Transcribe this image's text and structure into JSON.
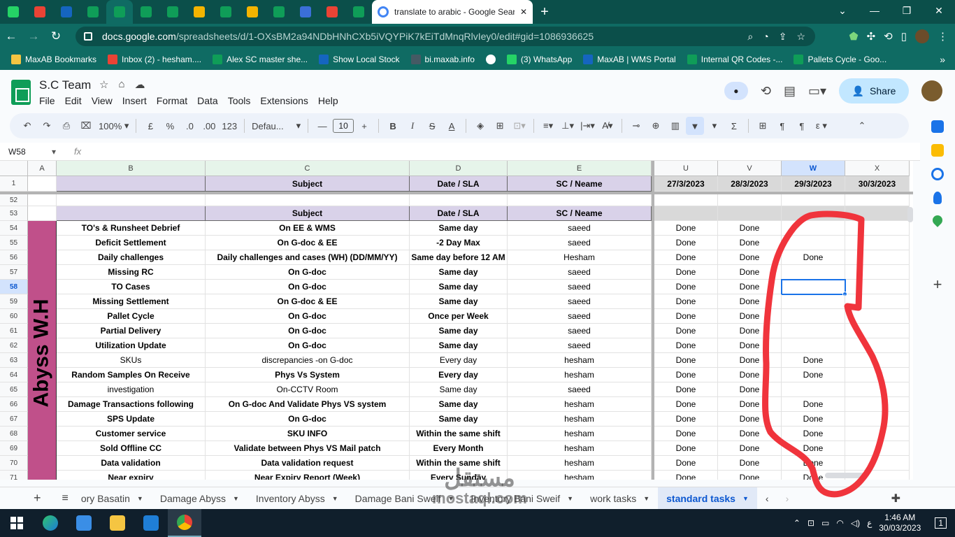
{
  "browser": {
    "active_tab_title": "translate to arabic - Google Search",
    "url_domain": "docs.google.com",
    "url_path": "/spreadsheets/d/1-OXsBM2a94NDbHNhCXb5iVQYPiK7kEiTdMnqRlvIey0/edit#gid=1086936625",
    "tab_icons": [
      "whatsapp-icon",
      "gmail-icon",
      "maxab-icon",
      "sheets-icon",
      "sheets-icon",
      "sheets-icon",
      "sheets-icon",
      "slides-icon",
      "sheets-icon",
      "slides-icon",
      "sheets-icon",
      "maxab-m-icon",
      "gmail-icon",
      "sheets-icon"
    ],
    "bookmarks": [
      {
        "label": "MaxAB Bookmarks",
        "icon": "folder-icon"
      },
      {
        "label": "Inbox (2) - hesham....",
        "icon": "gmail-icon"
      },
      {
        "label": "Alex SC master she...",
        "icon": "sheets-icon"
      },
      {
        "label": "Show Local Stock",
        "icon": "maxab-icon"
      },
      {
        "label": "bi.maxab.info",
        "icon": "site-icon"
      },
      {
        "label": "",
        "icon": "globe-icon"
      },
      {
        "label": "(3) WhatsApp",
        "icon": "whatsapp-icon"
      },
      {
        "label": "MaxAB | WMS Portal",
        "icon": "maxab-icon"
      },
      {
        "label": "Internal QR Codes -...",
        "icon": "sheets-icon"
      },
      {
        "label": "Pallets Cycle - Goo...",
        "icon": "sheets-icon"
      }
    ]
  },
  "doc": {
    "title": "S.C Team",
    "menu": [
      "File",
      "Edit",
      "View",
      "Insert",
      "Format",
      "Data",
      "Tools",
      "Extensions",
      "Help"
    ],
    "share_label": "Share"
  },
  "toolbar": {
    "zoom": "100%",
    "currency": "£",
    "percent": "%",
    "dec_decrease": ".0",
    "dec_increase": ".00",
    "number_format": "123",
    "font": "Defau...",
    "font_size": "10"
  },
  "formula_bar": {
    "cell_ref": "W58",
    "fx": "fx"
  },
  "grid": {
    "left_columns": [
      "A",
      "B",
      "C",
      "D",
      "E"
    ],
    "right_columns": [
      "U",
      "V",
      "W",
      "X"
    ],
    "selected_column": "W",
    "header_row_num": "1",
    "header_cells": {
      "B": "",
      "C": "Subject",
      "D": "Date / SLA",
      "E": "SC / Neame"
    },
    "dates": [
      "27/3/2023",
      "28/3/2023",
      "29/3/2023",
      "30/3/2023"
    ],
    "row52": "52",
    "row53": {
      "num": "53",
      "B": "",
      "C": "Subject",
      "D": "Date / SLA",
      "E": "SC / Neame"
    },
    "group_label": "Abyss W.H",
    "selected_row": "58",
    "rows": [
      {
        "num": "54",
        "task": "TO's & Runsheet Debrief",
        "subject": "On EE & WMS",
        "sla": "Same day",
        "sc": "saeed",
        "u": "Done",
        "v": "Done",
        "w": "",
        "bold": true
      },
      {
        "num": "55",
        "task": "Deficit Settlement",
        "subject": "On G-doc & EE",
        "sla": "-2 Day Max",
        "sc": "saeed",
        "u": "Done",
        "v": "Done",
        "w": "",
        "bold": true
      },
      {
        "num": "56",
        "task": "Daily challenges",
        "subject": "Daily challenges and cases (WH) (DD/MM/YY)",
        "sla": "Same day before 12 AM",
        "sc": "Hesham",
        "u": "Done",
        "v": "Done",
        "w": "Done",
        "bold": true
      },
      {
        "num": "57",
        "task": "Missing RC",
        "subject": "On G-doc",
        "sla": "Same day",
        "sc": "saeed",
        "u": "Done",
        "v": "Done",
        "w": "",
        "bold": true
      },
      {
        "num": "58",
        "task": "TO Cases",
        "subject": "On G-doc",
        "sla": "Same day",
        "sc": "saeed",
        "u": "Done",
        "v": "Done",
        "w": "",
        "bold": true
      },
      {
        "num": "59",
        "task": "Missing Settlement",
        "subject": "On G-doc & EE",
        "sla": "Same day",
        "sc": "saeed",
        "u": "Done",
        "v": "Done",
        "w": "",
        "bold": true
      },
      {
        "num": "60",
        "task": "Pallet Cycle",
        "subject": "On G-doc",
        "sla": "Once per Week",
        "sc": "saeed",
        "u": "Done",
        "v": "Done",
        "w": "",
        "bold": true
      },
      {
        "num": "61",
        "task": "Partial Delivery",
        "subject": "On G-doc",
        "sla": "Same day",
        "sc": "saeed",
        "u": "Done",
        "v": "Done",
        "w": "",
        "bold": true
      },
      {
        "num": "62",
        "task": "Utilization Update",
        "subject": "On G-doc",
        "sla": "Same day",
        "sc": "saeed",
        "u": "Done",
        "v": "Done",
        "w": "",
        "bold": true
      },
      {
        "num": "63",
        "task": "SKUs",
        "subject": "discrepancies -on G-doc",
        "sla": "Every day",
        "sc": "hesham",
        "u": "Done",
        "v": "Done",
        "w": "Done",
        "bold": false
      },
      {
        "num": "64",
        "task": "Random Samples On Receive",
        "subject": "Phys Vs System",
        "sla": "Every day",
        "sc": "hesham",
        "u": "Done",
        "v": "Done",
        "w": "Done",
        "bold": true
      },
      {
        "num": "65",
        "task": "investigation",
        "subject": "On-CCTV Room",
        "sla": "Same day",
        "sc": "saeed",
        "u": "Done",
        "v": "Done",
        "w": "",
        "bold": false
      },
      {
        "num": "66",
        "task": "Damage Transactions following",
        "subject": "On G-doc And Validate Phys VS system",
        "sla": "Same day",
        "sc": "hesham",
        "u": "Done",
        "v": "Done",
        "w": "Done",
        "bold": true
      },
      {
        "num": "67",
        "task": "SPS Update",
        "subject": "On G-doc",
        "sla": "Same day",
        "sc": "hesham",
        "u": "Done",
        "v": "Done",
        "w": "Done",
        "bold": true
      },
      {
        "num": "68",
        "task": "Customer service",
        "subject": "SKU INFO",
        "sla": "Within the same shift",
        "sc": "hesham",
        "u": "Done",
        "v": "Done",
        "w": "Done",
        "bold": true
      },
      {
        "num": "69",
        "task": "Sold Offline CC",
        "subject": "Validate between Phys VS Mail patch",
        "sla": "Every Month",
        "sc": "hesham",
        "u": "Done",
        "v": "Done",
        "w": "Done",
        "bold": true
      },
      {
        "num": "70",
        "task": "Data validation",
        "subject": "Data validation request",
        "sla": "Within the same shift",
        "sc": "hesham",
        "u": "Done",
        "v": "Done",
        "w": "Done",
        "bold": true
      },
      {
        "num": "71",
        "task": "Near expiry",
        "subject": "Near Expiry Report (Week)",
        "sla": "Every Sunday",
        "sc": "hesham",
        "u": "Done",
        "v": "Done",
        "w": "Done",
        "bold": true
      }
    ]
  },
  "sheet_tabs": {
    "tabs": [
      "ory Basatin",
      "Damage Abyss",
      "Inventory Abyss",
      "Damage Bani Sweif",
      "Inventory Bani Sweif",
      "work tasks",
      "standard tasks"
    ],
    "active": "standard tasks"
  },
  "watermark": {
    "arabic": "مستقل",
    "latin": "mostaql.com"
  },
  "taskbar": {
    "time": "1:46 AM",
    "date": "30/03/2023",
    "lang": "ع",
    "notifications": "1"
  },
  "colors": {
    "accent": "#0b57d0",
    "header_purple": "#d9d2e9",
    "abyss_pink": "#c0508a",
    "browser_teal": "#0f6b63",
    "ink_red": "#f0343c"
  }
}
